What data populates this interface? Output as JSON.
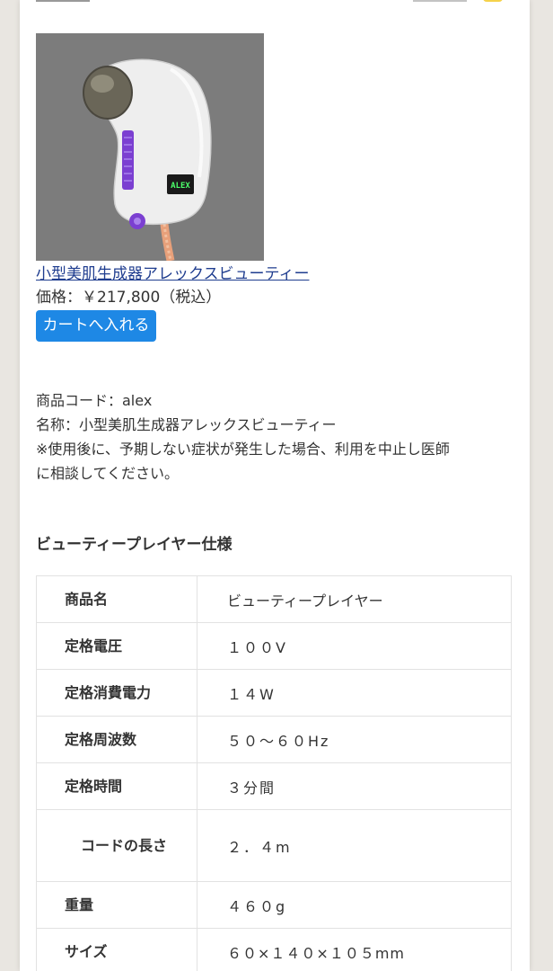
{
  "product": {
    "name": "小型美肌生成器アレックスビューティー",
    "price_label": "価格：￥217,800（税込）",
    "cart_button": "カートへ入れる",
    "image_device_label": "ALEX"
  },
  "info": {
    "code": "商品コード：alex",
    "name": "名称：小型美肌生成器アレックスビューティー",
    "note_line1": "※使用後に、予期しない症状が発生した場合、利用を中止し医師",
    "note_line2": "に相談してください。"
  },
  "spec": {
    "title": "ビューティープレイヤー仕様",
    "rows": [
      {
        "label": "商品名",
        "value": "ビューティープレイヤー"
      },
      {
        "label": "定格電圧",
        "value": "１００V"
      },
      {
        "label": "定格消費電力",
        "value": "１４W"
      },
      {
        "label": "定格周波数",
        "value": "５０〜６０Hz"
      },
      {
        "label": "定格時間",
        "value": "３分間"
      },
      {
        "label": "コードの長さ",
        "value": "２．４m"
      },
      {
        "label": "重量",
        "value": "４６０g"
      },
      {
        "label": "サイズ",
        "value": "６０×１４０×１０５mm"
      }
    ]
  },
  "colors": {
    "link": "#1f3d8f",
    "button": "#1e88e5",
    "image_bg": "#7c7c7c",
    "accent_purple": "#7b3fd1"
  }
}
